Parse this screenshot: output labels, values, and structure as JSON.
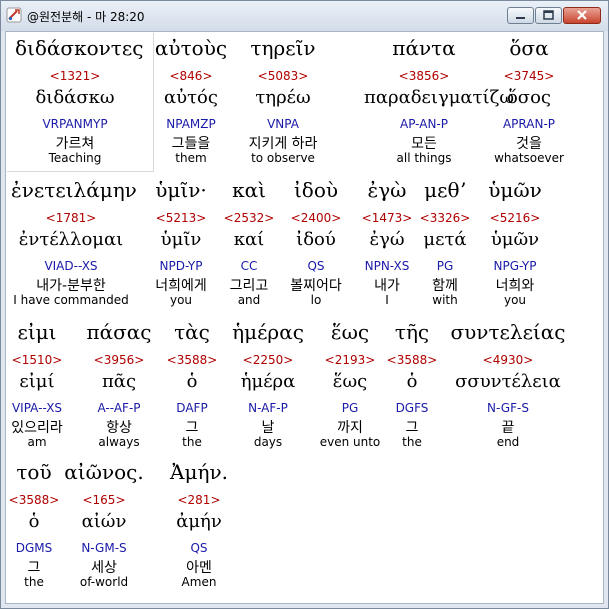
{
  "window": {
    "title": "@원전분해 - 마 28:20",
    "minimize_icon": "minimize-icon",
    "maximize_icon": "maximize-icon",
    "close_icon": "close-icon",
    "app_icon": "app-icon"
  },
  "colors": {
    "strong_number": "#b00000",
    "parsing": "#1a1aa8",
    "text": "#000000",
    "close_button": "#c8452f"
  },
  "lines": [
    {
      "words": [
        {
          "greek": "διδάσκοντες",
          "strong": "<1321>",
          "lemma": "διδάσκω",
          "parsing": "VRPANMYP",
          "korean": "가르쳐",
          "english": "Teaching",
          "selected": true
        },
        {
          "greek": "αὐτοὺς",
          "strong": "<846>",
          "lemma": "αὐτός",
          "parsing": "NPAMZP",
          "korean": "그들을",
          "english": "them"
        },
        {
          "greek": "τηρεῖν",
          "strong": "<5083>",
          "lemma": "τηρέω",
          "parsing": "VNPA",
          "korean": "지키게 하라",
          "english": "to observe"
        },
        {
          "greek": "πάντα",
          "strong": "<3856>",
          "lemma": "παραδειγματίζω",
          "parsing": "AP-AN-P",
          "korean": "모든",
          "english": "all things"
        },
        {
          "greek": "ὅσα",
          "strong": "<3745>",
          "lemma": "ὅσος",
          "parsing": "APRAN-P",
          "korean": "것을",
          "english": "whatsoever"
        }
      ]
    },
    {
      "words": [
        {
          "greek": "ἐνετειλάμην",
          "strong": "<1781>",
          "lemma": "ἐντέλλομαι",
          "parsing": "VIAD--XS",
          "korean": "내가-분부한",
          "english": "I have commanded"
        },
        {
          "greek": "ὑμῖν·",
          "strong": "<5213>",
          "lemma": "ὑμῖν",
          "parsing": "NPD-YP",
          "korean": "너희에게",
          "english": "you"
        },
        {
          "greek": "καὶ",
          "strong": "<2532>",
          "lemma": "καί",
          "parsing": "CC",
          "korean": "그리고",
          "english": "and"
        },
        {
          "greek": "ἰδοὺ",
          "strong": "<2400>",
          "lemma": "ἰδού",
          "parsing": "QS",
          "korean": "볼찌어다",
          "english": "lo"
        },
        {
          "greek": "ἐγὼ",
          "strong": "<1473>",
          "lemma": "ἐγώ",
          "parsing": "NPN-XS",
          "korean": "내가",
          "english": "I"
        },
        {
          "greek": "μεθʼ",
          "strong": "<3326>",
          "lemma": "μετά",
          "parsing": "PG",
          "korean": "함께",
          "english": "with"
        },
        {
          "greek": "ὑμῶν",
          "strong": "<5216>",
          "lemma": "ὑμῶν",
          "parsing": "NPG-YP",
          "korean": "너희와",
          "english": "you"
        }
      ]
    },
    {
      "words": [
        {
          "greek": "εἰμι",
          "strong": "<1510>",
          "lemma": "εἰμί",
          "parsing": "VIPA--XS",
          "korean": "있으리라",
          "english": "am"
        },
        {
          "greek": "πάσας",
          "strong": "<3956>",
          "lemma": "πᾶς",
          "parsing": "A--AF-P",
          "korean": "항상",
          "english": "always"
        },
        {
          "greek": "τὰς",
          "strong": "<3588>",
          "lemma": "ὁ",
          "parsing": "DAFP",
          "korean": "그",
          "english": "the"
        },
        {
          "greek": "ἡμέρας",
          "strong": "<2250>",
          "lemma": "ἡμέρα",
          "parsing": "N-AF-P",
          "korean": "날",
          "english": "days"
        },
        {
          "greek": "ἕως",
          "strong": "<2193>",
          "lemma": "ἕως",
          "parsing": "PG",
          "korean": "까지",
          "english": "even unto"
        },
        {
          "greek": "τῆς",
          "strong": "<3588>",
          "lemma": "ὁ",
          "parsing": "DGFS",
          "korean": "그",
          "english": "the"
        },
        {
          "greek": "συντελείας",
          "strong": "<4930>",
          "lemma": "σσυντέλεια",
          "parsing": "N-GF-S",
          "korean": "끝",
          "english": "end"
        }
      ]
    },
    {
      "words": [
        {
          "greek": "τοῦ",
          "strong": "<3588>",
          "lemma": "ὁ",
          "parsing": "DGMS",
          "korean": "그",
          "english": "the"
        },
        {
          "greek": "αἰῶνος.",
          "strong": "<165>",
          "lemma": "αἰών",
          "parsing": "N-GM-S",
          "korean": "세상",
          "english": "of-world"
        },
        {
          "greek": "Ἀμήν.",
          "strong": "<281>",
          "lemma": "ἀμήν",
          "parsing": "QS",
          "korean": "아멘",
          "english": "Amen"
        }
      ]
    }
  ]
}
